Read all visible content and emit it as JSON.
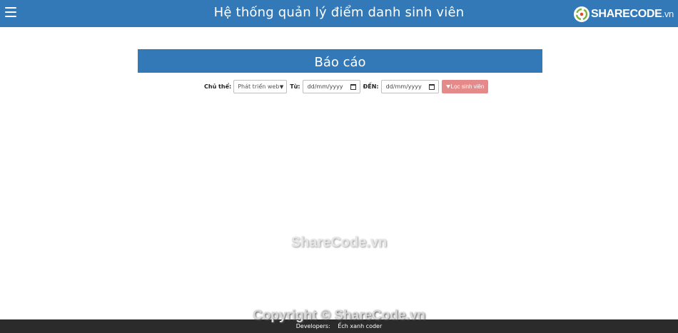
{
  "header": {
    "title": "Hệ thống quản lý điểm danh sinh viên",
    "brand": {
      "strong": "SHARECODE",
      "suffix": ".vn"
    }
  },
  "report": {
    "title": "Báo cáo",
    "filters": {
      "subject_label": "Chủ thể:",
      "subject_value": "Phát triển web",
      "from_label": "Từ:",
      "from_placeholder": "dd/mm/yyyy",
      "to_label": "ĐẾN:",
      "to_placeholder": "dd/mm/yyyy",
      "filter_button": "Lọc sinh viên"
    }
  },
  "watermark": "ShareCode.vn",
  "footer": {
    "copyright": "Copyright © ShareCode.vn",
    "developers_label": "Developers:",
    "developers_name": "Ếch xanh coder"
  },
  "colors": {
    "primary": "#3479b7",
    "filter_button": "#e58a8a",
    "footer": "#2b2b2b"
  }
}
